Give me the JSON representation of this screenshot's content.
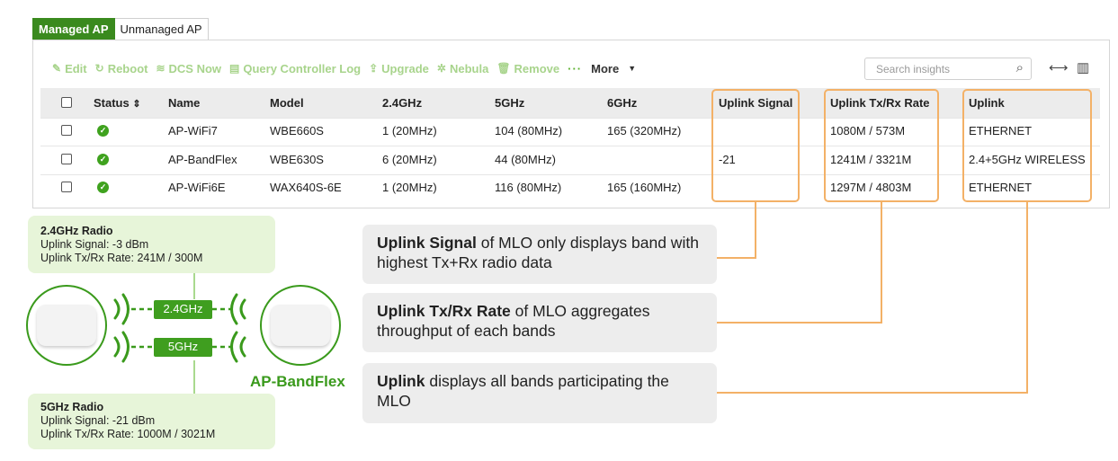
{
  "tabs": {
    "managed": "Managed AP",
    "unmanaged": "Unmanaged AP"
  },
  "toolbar": {
    "edit": "Edit",
    "reboot": "Reboot",
    "dcs_now": "DCS Now",
    "query_log": "Query Controller Log",
    "upgrade": "Upgrade",
    "nebula": "Nebula",
    "remove": "Remove",
    "dots": "···",
    "more": "More"
  },
  "search": {
    "placeholder": "Search insights"
  },
  "table": {
    "headers": [
      "Status",
      "Name",
      "Model",
      "2.4GHz",
      "5GHz",
      "6GHz",
      "Uplink Signal",
      "Uplink Tx/Rx Rate",
      "Uplink"
    ],
    "rows": [
      {
        "name": "AP-WiFi7",
        "model": "WBE660S",
        "b24": "1 (20MHz)",
        "b5": "104 (80MHz)",
        "b6": "165 (320MHz)",
        "signal": "",
        "rate": "1080M / 573M",
        "uplink": "ETHERNET"
      },
      {
        "name": "AP-BandFlex",
        "model": "WBE630S",
        "b24": "6 (20MHz)",
        "b5": "44 (80MHz)",
        "b6": "",
        "signal": "-21",
        "rate": "1241M / 3321M",
        "uplink": "2.4+5GHz WIRELESS"
      },
      {
        "name": "AP-WiFi6E",
        "model": "WAX640S-6E",
        "b24": "1 (20MHz)",
        "b5": "116 (80MHz)",
        "b6": "165 (160MHz)",
        "signal": "",
        "rate": "1297M / 4803M",
        "uplink": "ETHERNET"
      }
    ]
  },
  "radio24": {
    "title": "2.4GHz Radio",
    "signal": "Uplink Signal: -3 dBm",
    "rate": "Uplink Tx/Rx Rate: 241M / 300M"
  },
  "radio5": {
    "title": "5GHz Radio",
    "signal": "Uplink Signal: -21 dBm",
    "rate": "Uplink Tx/Rx Rate: 1000M / 3021M"
  },
  "bands": {
    "b24": "2.4GHz",
    "b5": "5GHz"
  },
  "ap_name": "AP-BandFlex",
  "callouts": [
    {
      "bold": "Uplink Signal",
      "text": " of MLO only displays band with highest Tx+Rx radio data"
    },
    {
      "bold": "Uplink Tx/Rx Rate",
      "text": " of MLO aggregates throughput of each bands"
    },
    {
      "bold": "Uplink",
      "text": " displays all bands participating the MLO"
    }
  ],
  "colors": {
    "accent_green": "#3f9e1f",
    "highlight_orange": "#f3b167"
  }
}
